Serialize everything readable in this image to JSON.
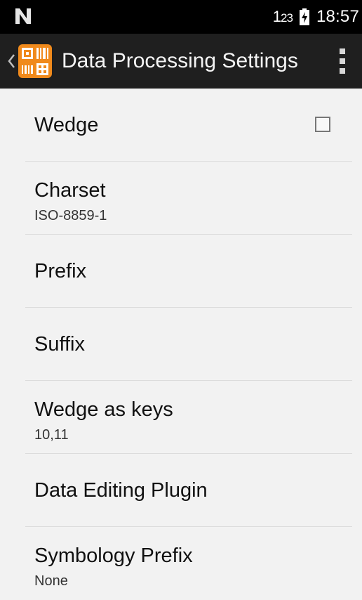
{
  "status_bar": {
    "network_main": "1",
    "network_sub": "23",
    "time": "18:57",
    "icons": [
      "notification-n-icon",
      "battery-charging-icon"
    ]
  },
  "toolbar": {
    "title": "Data Processing Settings",
    "icons": [
      "back-chevron-icon",
      "app-barcode-icon",
      "overflow-menu-icon"
    ]
  },
  "preferences": [
    {
      "title": "Wedge",
      "summary": "",
      "checked": false
    },
    {
      "title": "Charset",
      "summary": "ISO-8859-1"
    },
    {
      "title": "Prefix",
      "summary": ""
    },
    {
      "title": "Suffix",
      "summary": ""
    },
    {
      "title": "Wedge as keys",
      "summary": "10,11"
    },
    {
      "title": "Data Editing Plugin",
      "summary": ""
    },
    {
      "title": "Symbology Prefix",
      "summary": "None"
    }
  ],
  "colors": {
    "status_bar_bg": "#000000",
    "action_bar_bg": "#1f1f1f",
    "list_bg": "#f2f2f2",
    "app_icon_orange": "#f08a1c"
  }
}
